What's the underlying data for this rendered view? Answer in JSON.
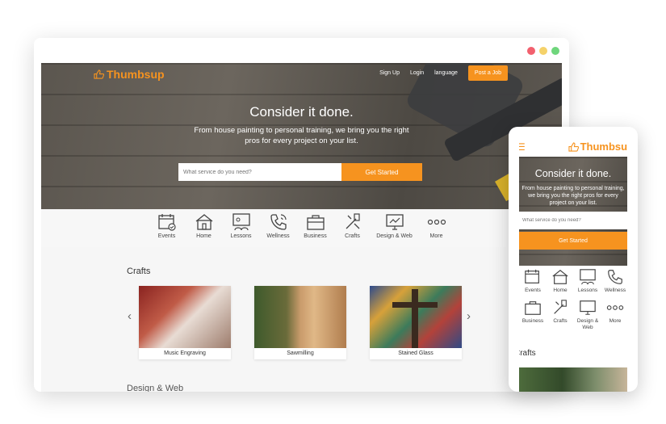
{
  "colors": {
    "accent": "#f6931f",
    "dot_red": "#f2606e",
    "dot_yellow": "#f5d26a",
    "dot_green": "#6fd67c"
  },
  "brand": {
    "name": "Thumbsup",
    "icon": "thumbs-up-icon"
  },
  "nav": {
    "sign_up": "Sign Up",
    "login": "Login",
    "language": "language",
    "post_job": "Post a Job"
  },
  "hero": {
    "title": "Consider it done.",
    "subtitle": "From house painting to personal training, we bring you the right pros for every project on your list.",
    "search_placeholder": "What service do you need?",
    "cta": "Get Started"
  },
  "categories": [
    {
      "label": "Events",
      "icon": "calendar-icon"
    },
    {
      "label": "Home",
      "icon": "house-icon"
    },
    {
      "label": "Lessons",
      "icon": "board-icon"
    },
    {
      "label": "Wellness",
      "icon": "phone-icon"
    },
    {
      "label": "Business",
      "icon": "briefcase-icon"
    },
    {
      "label": "Crafts",
      "icon": "crafts-icon"
    },
    {
      "label": "Design & Web",
      "icon": "monitor-icon"
    },
    {
      "label": "More",
      "icon": "more-icon"
    }
  ],
  "crafts": {
    "title": "Crafts",
    "cards": [
      {
        "label": "Music Engraving"
      },
      {
        "label": "Sawmilling"
      },
      {
        "label": "Stained Glass"
      }
    ]
  },
  "next_section_partial": "Design & Web",
  "mobile": {
    "brand": "Thumbsup",
    "title": "Consider it done.",
    "subtitle": "From house painting to personal training, we bring you the right pros for every project on your list.",
    "search_placeholder": "What service do you need?",
    "cta": "Get Started",
    "section_title": "Crafts"
  }
}
